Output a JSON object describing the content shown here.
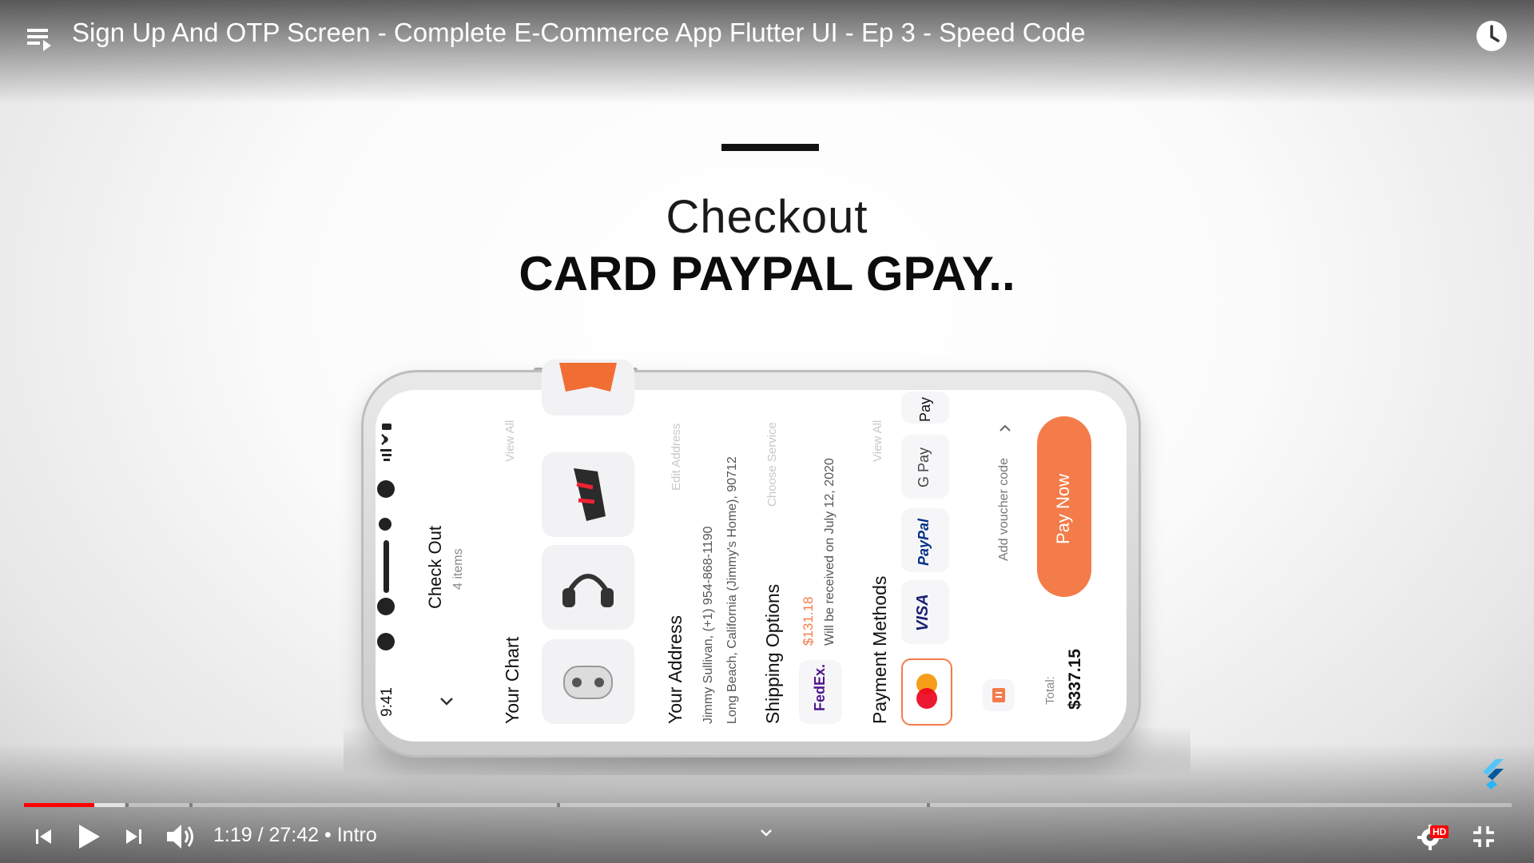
{
  "player": {
    "title": "Sign Up And OTP Screen - Complete E-Commerce App Flutter UI - Ep 3 - Speed Code",
    "current_time": "1:19",
    "duration": "27:42",
    "chapter": "Intro",
    "progress_fraction": 0.047,
    "hd_badge": "HD",
    "accent_color": "#ff0000"
  },
  "hero": {
    "line1": "Checkout",
    "line2": "CARD PAYPAL GPAY.."
  },
  "app": {
    "status_time": "9:41",
    "header_title": "Check Out",
    "header_subtitle": "4 items",
    "cart_label": "Your Chart",
    "cart_view_all": "View All",
    "address_label": "Your Address",
    "address_line1": "Jimmy Sullivan, (+1) 954-868-1190",
    "address_line2": "Long Beach, California (Jimmy's Home), 90712",
    "edit_address": "Edit Address",
    "shipping_label": "Shipping Options",
    "shipping_price": "$131.18",
    "shipping_note": "Will be received on July 12, 2020",
    "choose_service": "Choose Service",
    "carrier": "FedEx.",
    "payment_label": "Payment Methods",
    "payment_view_all": "View All",
    "payment_methods": [
      "VISA",
      "PayPal",
      "G Pay",
      "Pay"
    ],
    "voucher_label": "Add voucher code",
    "total_label": "Total:",
    "total_value": "$337.15",
    "pay_now": "Pay Now",
    "accent_color": "#f47c4a"
  }
}
